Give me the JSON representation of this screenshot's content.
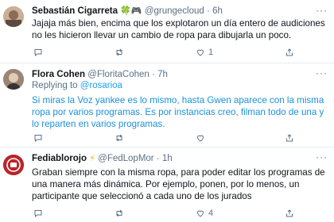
{
  "tweets": [
    {
      "name": "Sebastián Cigarreta",
      "name_emoji": "🍀🎮",
      "handle": "@grungecloud",
      "sep": "·",
      "time": "6h",
      "text": "Jajaja más bien, encima que los explotaron un día entero de audiciones no les hicieron llevar un cambio de ropa para dibujarla un poco.",
      "replying_label": "",
      "replying_to": "",
      "replies": "",
      "retweets": "",
      "likes": "1"
    },
    {
      "name": "Flora Cohen",
      "name_emoji": "",
      "handle": "@FloritaCohen",
      "sep": "·",
      "time": "7h",
      "replying_label": "Replying to ",
      "replying_to": "@rosarioa",
      "text": "Si miras la Voz yankee es lo mismo, hasta Gwen aparece con la misma ropa por varios programas. Es por instancias creo, filman todo de una y lo reparten en varios programas.",
      "replies": "",
      "retweets": "",
      "likes": ""
    },
    {
      "name": "Fediablorojo",
      "name_emoji": "⚡",
      "handle": "@FedLopMor",
      "sep": "·",
      "time": "1h",
      "text": "Graban siempre con la misma ropa, para poder editar los programas de una manera más dinámica. Por ejemplo, ponen, por lo menos, un participante que seleccionó a cada uno de los jurados",
      "replying_label": "",
      "replying_to": "",
      "replies": "",
      "retweets": "",
      "likes": "4"
    }
  ],
  "icons": [
    "reply-icon",
    "retweet-icon",
    "like-icon",
    "share-icon",
    "more-icon"
  ]
}
